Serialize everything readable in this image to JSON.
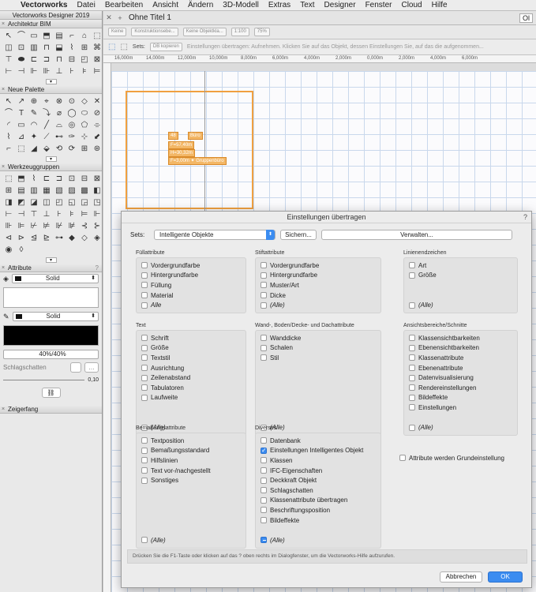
{
  "menubar": {
    "items": [
      "Vectorworks",
      "Datei",
      "Bearbeiten",
      "Ansicht",
      "Ändern",
      "3D-Modell",
      "Extras",
      "Text",
      "Designer",
      "Fenster",
      "Cloud",
      "Hilfe"
    ]
  },
  "app_title": "Vectorworks Designer 2019",
  "document": {
    "title": "Ohne Titel 1",
    "ol_badge": "Ol",
    "view_selects": [
      "Keine",
      "Konstruktionsebe...",
      "Keine Objektkla...",
      "1:100",
      "75%"
    ]
  },
  "modebar": {
    "sets_label": "Sets:",
    "sets_value": "DB kopieren",
    "hint": "Einstellungen übertragen: Aufnehmen. Klicken Sie auf das Objekt, dessen Einstellungen Sie, auf das die aufgenommen..."
  },
  "ruler": {
    "labels": [
      "16,000m",
      "14,000m",
      "12,000m",
      "10,000m",
      "8,000m",
      "6,000m",
      "4,000m",
      "2,000m",
      "0,000m",
      "2,000m",
      "4,000m",
      "6,000m"
    ]
  },
  "room": {
    "number": "48",
    "name": "Büro",
    "area": "F=57,40m",
    "height": "H=30,32m",
    "extra": "F=3,00m ✦ Gruppenbüro"
  },
  "palettes": {
    "architektur": "Architektur BIM",
    "neue": "Neue Palette",
    "werkzeug": "Werkzeuggruppen",
    "attribute": "Attribute",
    "zeigerfang": "Zeigerfang",
    "fill_style": "Solid",
    "pen_style": "Solid",
    "opacity": "40%/40%",
    "shadow_label": "Schlagschatten",
    "line_value": "0,10"
  },
  "dialog": {
    "title": "Einstellungen übertragen",
    "help": "?",
    "sets_label": "Sets:",
    "sets_value": "Intelligente Objekte",
    "save_button": "Sichern...",
    "manage_button": "Verwalten...",
    "groups": {
      "fill": {
        "title": "Füllattribute",
        "items": [
          "Vordergrundfarbe",
          "Hintergrundfarbe",
          "Füllung",
          "Material"
        ],
        "all": "Alle"
      },
      "stroke": {
        "title": "Stiftattribute",
        "items": [
          "Vordergrundfarbe",
          "Hintergrundfarbe",
          "Muster/Art",
          "Dicke"
        ],
        "all": "(Alle)"
      },
      "line": {
        "title": "Linienendzeichen",
        "items": [
          "Art",
          "Größe"
        ],
        "all": "(Alle)"
      },
      "text": {
        "title": "Text",
        "items": [
          "Schrift",
          "Größe",
          "Textstil",
          "Ausrichtung",
          "Zeilenabstand",
          "Tabulatoren",
          "Laufweite"
        ],
        "all": "(Alle)"
      },
      "wall": {
        "title": "Wand-, Boden/Decke- und Dachattribute",
        "items": [
          "Wanddicke",
          "Schalen",
          "Stil"
        ],
        "all": "(Alle)"
      },
      "view": {
        "title": "Ansichtsbereiche/Schnitte",
        "items": [
          "Klassensichtbarkeiten",
          "Ebenensichtbarkeiten",
          "Klassenattribute",
          "Ebenenattribute",
          "Datenvisualisierung",
          "Rendereinstellungen",
          "Bildeffekte",
          "Einstellungen"
        ],
        "all": "(Alle)"
      },
      "dim": {
        "title": "Bemaßungsattribute",
        "items": [
          "Textposition",
          "Bemaßungsstandard",
          "Hilfslinien",
          "Text vor-/nachgestellt",
          "Sonstiges"
        ],
        "all": "(Alle)"
      },
      "misc": {
        "title": "Diverses",
        "items": [
          "Datenbank",
          "Einstellungen Intelligentes Objekt",
          "Klassen",
          "IFC-Eigenschaften",
          "Deckkraft Objekt",
          "Schlagschatten",
          "Klassenattribute übertragen",
          "Beschriftungsposition",
          "Bildeffekte"
        ],
        "all": "(Alle)"
      }
    },
    "basic_attr": "Attribute werden Grundeinstellung",
    "hint": "Drücken Sie die F1-Taste oder klicken auf das ? oben rechts im Dialogfenster, um die Vectorworks-Hilfe aufzurufen.",
    "cancel": "Abbrechen",
    "ok": "OK"
  },
  "colors": {
    "accent": "#3b8cf0",
    "room": "#f0a040"
  }
}
